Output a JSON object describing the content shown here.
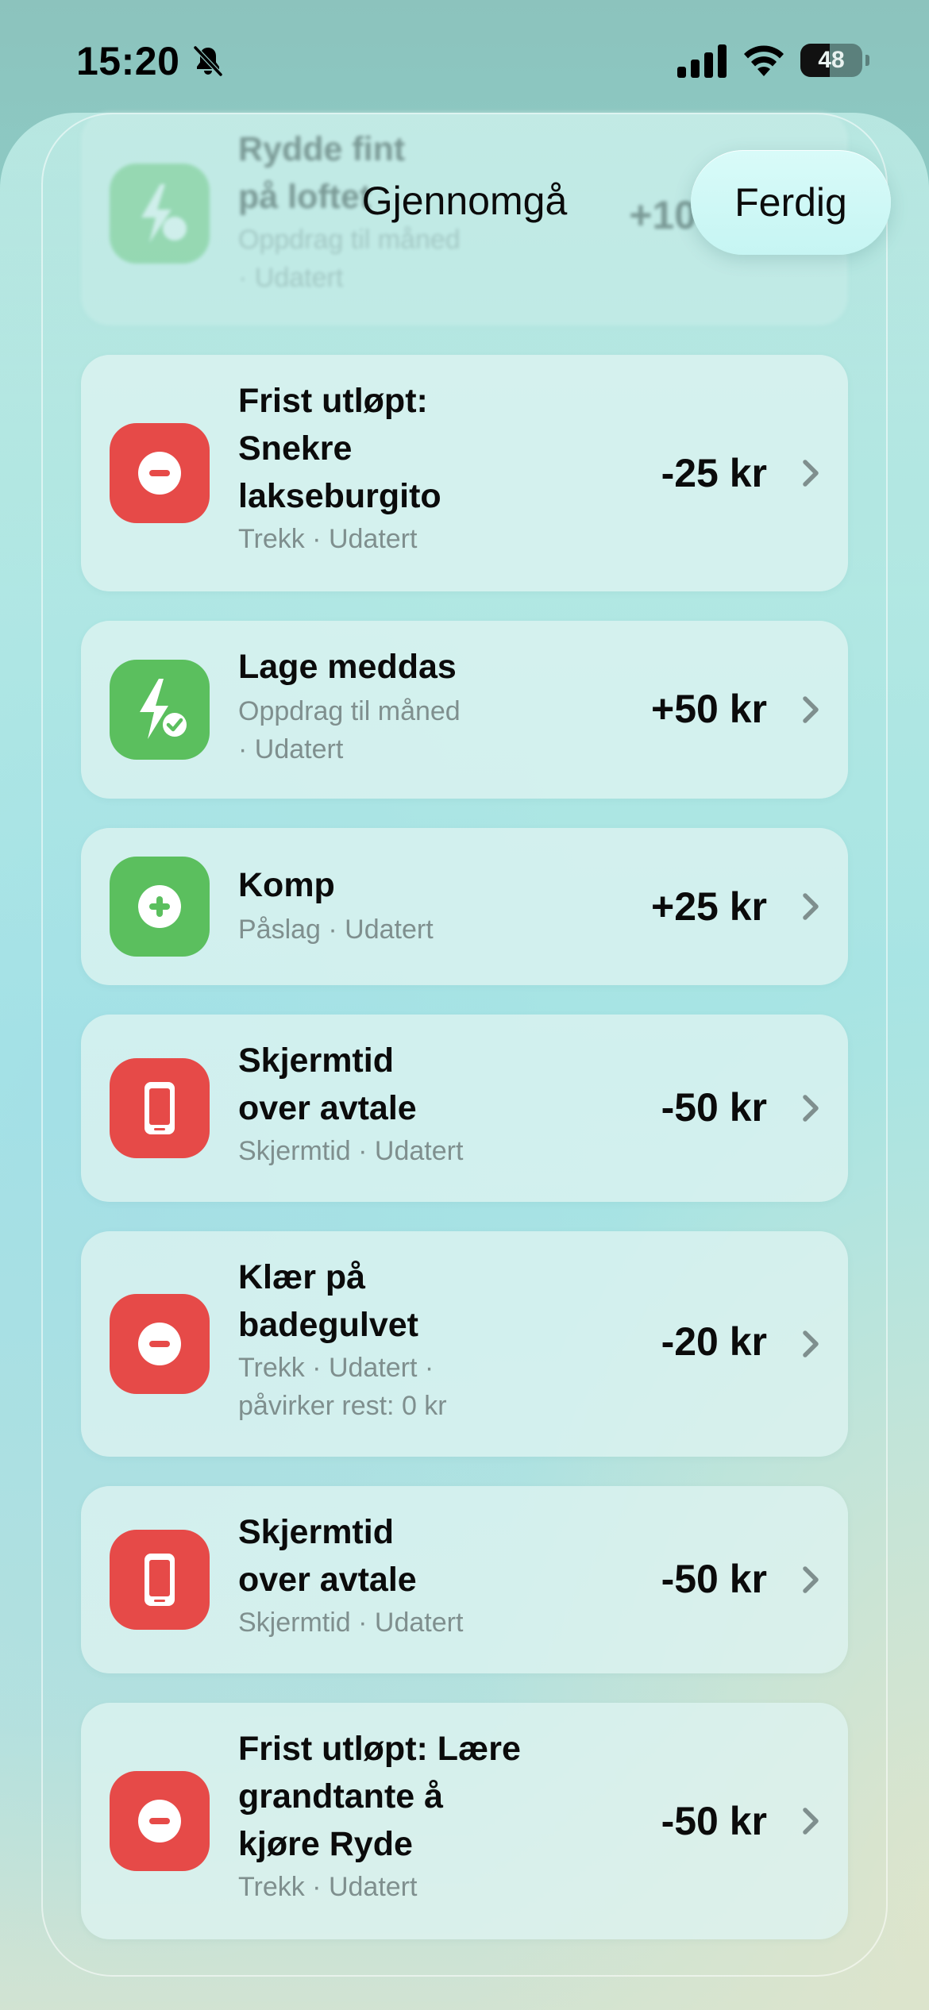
{
  "status_bar": {
    "time": "15:20",
    "battery_percent": 48
  },
  "header": {
    "title": "Gjennomgå",
    "done_label": "Ferdig"
  },
  "partial_item": {
    "title_line1": "Rydde fint",
    "title_line2": "på loftet",
    "subtitle_line1": "Oppdrag til måned",
    "subtitle_line2": "· Udatert",
    "amount": "+100 kr",
    "icon": "lightning-check-icon",
    "color": "#5bbf5e"
  },
  "items": [
    {
      "title": [
        "Frist utløpt:",
        "Snekre",
        "lakseburgito"
      ],
      "subtitle": [
        "Trekk · Udatert"
      ],
      "amount": "-25 kr",
      "icon": "minus-circle-icon",
      "color": "#e64a48"
    },
    {
      "title": [
        "Lage meddas"
      ],
      "subtitle": [
        "Oppdrag til måned",
        "· Udatert"
      ],
      "amount": "+50 kr",
      "icon": "lightning-check-icon",
      "color": "#5bbf5e"
    },
    {
      "title": [
        "Komp"
      ],
      "subtitle": [
        "Påslag · Udatert"
      ],
      "amount": "+25 kr",
      "icon": "plus-circle-icon",
      "color": "#5bbf5e"
    },
    {
      "title": [
        "Skjermtid",
        "over avtale"
      ],
      "subtitle": [
        "Skjermtid · Udatert"
      ],
      "amount": "-50 kr",
      "icon": "phone-icon",
      "color": "#e64a48"
    },
    {
      "title": [
        "Klær på",
        "badegulvet"
      ],
      "subtitle": [
        "Trekk · Udatert ·",
        "påvirker rest: 0 kr"
      ],
      "amount": "-20 kr",
      "icon": "minus-circle-icon",
      "color": "#e64a48"
    },
    {
      "title": [
        "Skjermtid",
        "over avtale"
      ],
      "subtitle": [
        "Skjermtid · Udatert"
      ],
      "amount": "-50 kr",
      "icon": "phone-icon",
      "color": "#e64a48"
    },
    {
      "title": [
        "Frist utløpt: Lære",
        "grandtante å",
        "kjøre Ryde"
      ],
      "subtitle": [
        "Trekk · Udatert"
      ],
      "amount": "-50 kr",
      "icon": "minus-circle-icon",
      "color": "#e64a48"
    }
  ]
}
